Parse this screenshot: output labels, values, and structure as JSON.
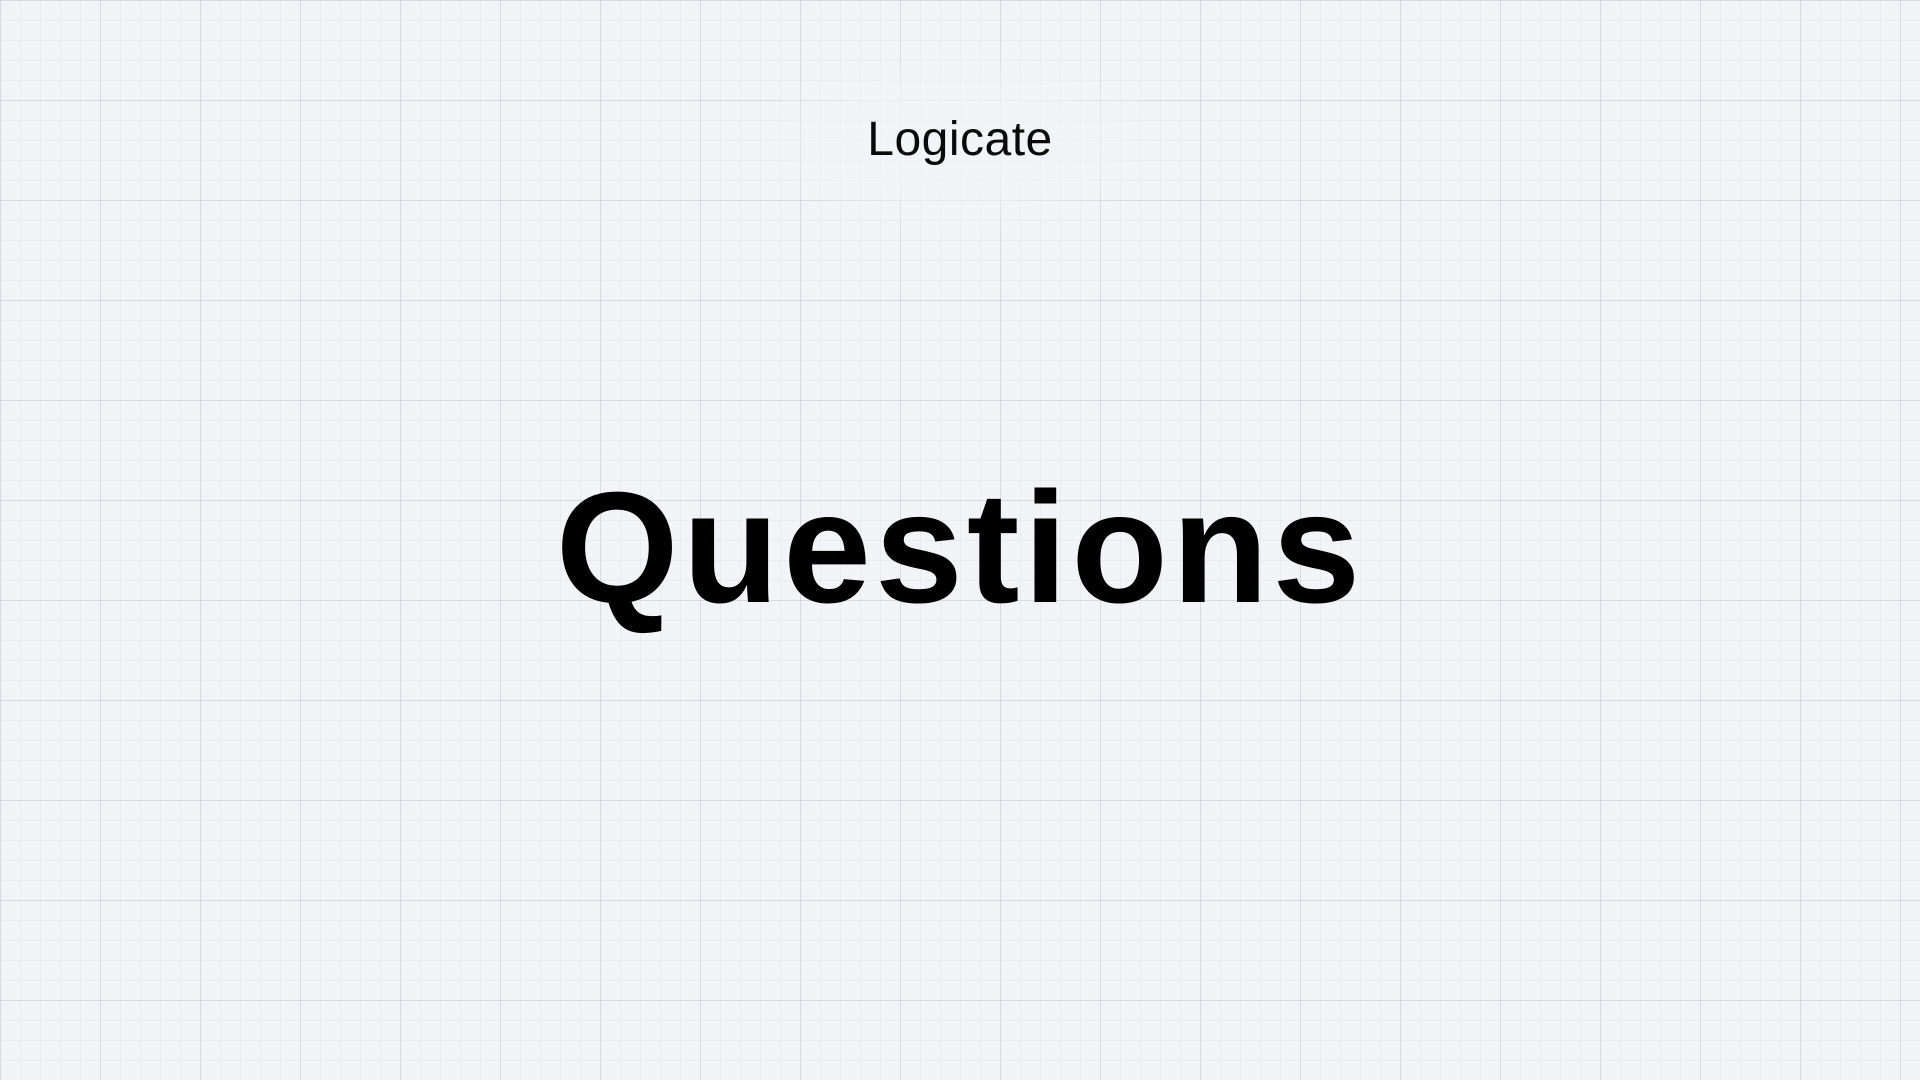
{
  "brand": {
    "name": "Logicate"
  },
  "slide": {
    "title": "Questions"
  },
  "colors": {
    "background": "#f3f4f7",
    "grid": "#a0aabd",
    "text": "#000000"
  }
}
